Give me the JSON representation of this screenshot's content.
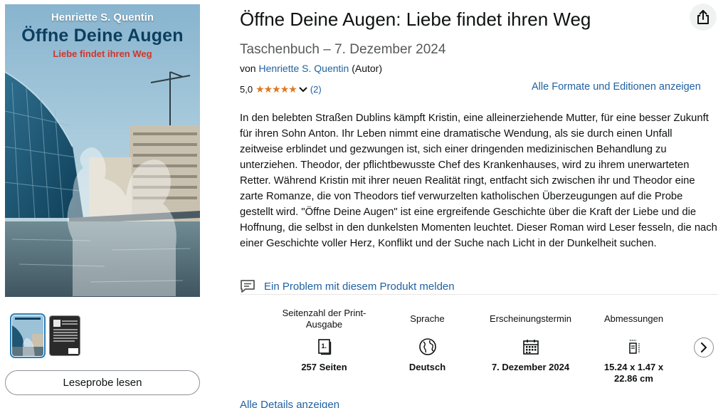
{
  "product": {
    "title": "Öffne Deine Augen: Liebe findet ihren Weg",
    "format_date": "Taschenbuch – 7. Dezember 2024",
    "by_prefix": "von",
    "author": "Henriette S. Quentin",
    "author_role": "(Autor)",
    "rating_value": "5,0",
    "stars": "★★★★★",
    "review_count": "(2)",
    "formats_link": "Alle Formate und Editionen anzeigen",
    "description": "In den belebten Straßen Dublins kämpft Kristin, eine alleinerziehende Mutter, für eine besser Zukunft für ihren Sohn Anton. Ihr Leben nimmt eine dramatische Wendung, als sie durch einen Unfall zeitweise erblindet und gezwungen ist, sich einer dringenden medizinischen Behandlung zu unterziehen. Theodor, der pflichtbewusste Chef des Krankenhauses, wird zu ihrem unerwarteten Retter. Während Kristin mit ihrer neuen Realität ringt, entfacht sich zwischen ihr und Theodor eine zarte Romanze, die von Theodors tief verwurzelten katholischen Überzeugungen auf die Probe gestellt wird. \"Öffne Deine Augen\" ist eine ergreifende Geschichte über die Kraft der Liebe und die Hoffnung, die selbst in den dunkelsten Momenten leuchtet. Dieser Roman wird Leser fesseln, die nach einer Geschichte voller Herz, Konflikt und der Suche nach Licht in der Dunkelheit suchen.",
    "report_link": "Ein Problem mit diesem Produkt melden",
    "all_details_link": "Alle Details anzeigen"
  },
  "cover": {
    "author": "Henriette S. Quentin",
    "title": "Öffne Deine Augen",
    "subtitle": "Liebe findet ihren Weg"
  },
  "sample_button": "Leseprobe lesen",
  "details": [
    {
      "label": "Seitenzahl der Print-Ausgabe",
      "icon": "book-pages-icon",
      "value": "257 Seiten"
    },
    {
      "label": "Sprache",
      "icon": "globe-icon",
      "value": "Deutsch"
    },
    {
      "label": "Erscheinungstermin",
      "icon": "calendar-icon",
      "value": "7. Dezember 2024"
    },
    {
      "label": "Abmessungen",
      "icon": "dimensions-icon",
      "value": "15.24 x 1.47 x 22.86 cm"
    }
  ],
  "colors": {
    "link": "#2162a1",
    "star": "#de7921",
    "text": "#0f1111",
    "muted": "#565959"
  }
}
